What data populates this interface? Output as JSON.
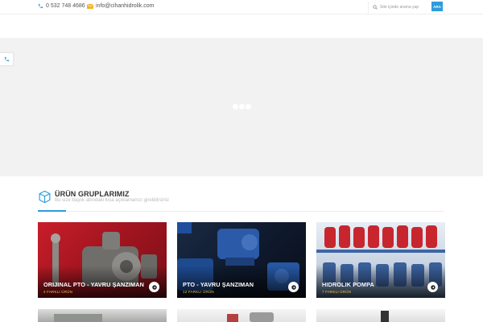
{
  "topbar": {
    "phone": "0 532 748 4686",
    "email": "info@cihanhidrolik.com",
    "search_placeholder": "Site içinde arama yap",
    "search_button": "ARA"
  },
  "section": {
    "title": "ÜRÜN GRUPLARIMIZ",
    "subtitle": "Bu size başlık altındaki kısa açıklamanızı girebilirsiniz"
  },
  "products": [
    {
      "title": "ORIJINAL PTO - YAVRU ŞANZIMAN",
      "count": "4 FARKLI ÜRÜN"
    },
    {
      "title": "PTO - YAVRU ŞANZIMAN",
      "count": "12 FARKLI ÜRÜN"
    },
    {
      "title": "HIDROLIK POMPA",
      "count": "7 FARKLI ÜRÜN"
    }
  ],
  "colors": {
    "accent": "#2d9cdb",
    "count_text": "#f5c542",
    "slider_bg": "#f2f2f2"
  },
  "icons": {
    "phone": "phone-icon",
    "mail": "mail-icon",
    "search": "search-icon",
    "box": "box-icon",
    "arrow": "arrow-right-icon"
  }
}
